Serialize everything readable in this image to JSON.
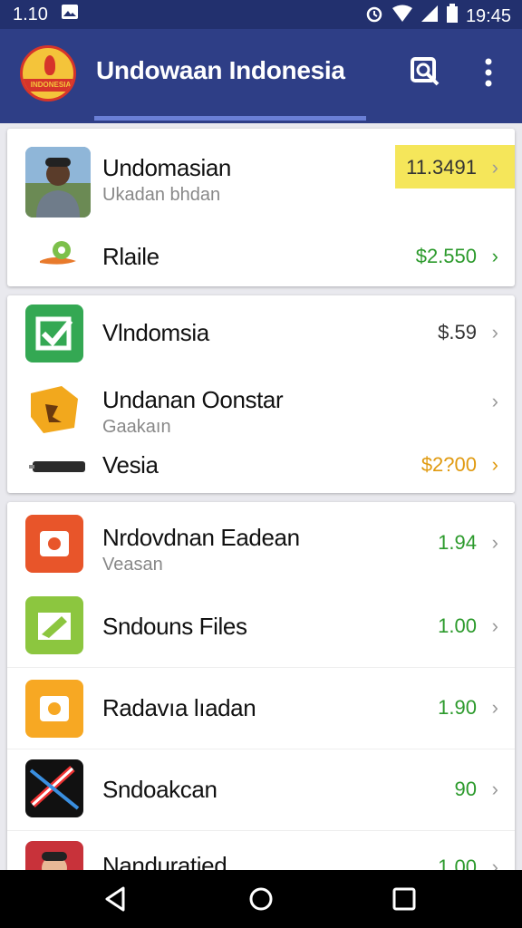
{
  "status_bar": {
    "left_time": "1.10",
    "right_time": "19:45",
    "icons": [
      "image-icon",
      "alarm-icon",
      "wifi-icon",
      "signal-icon",
      "battery-icon"
    ]
  },
  "app_bar": {
    "title": "Undowaan Indonesia",
    "logo_text": "INDONESIA",
    "actions": [
      "search-icon",
      "more-vert-icon"
    ]
  },
  "cards": [
    {
      "rows": [
        {
          "title": "Undomasian",
          "subtitle": "Ukadan bhdan",
          "value": "11.3491",
          "value_color": "#333333",
          "highlight": "#f5e65a"
        },
        {
          "title": "Rlaile",
          "subtitle": "",
          "value": "$2.550",
          "value_color": "#2c9a2c"
        }
      ]
    },
    {
      "rows": [
        {
          "title": "Vlndomsia",
          "subtitle": "",
          "value": "$.59",
          "value_color": "#333333"
        },
        {
          "title": "Undanan Oonstar",
          "subtitle": "Gaakaın",
          "value": "",
          "value_color": "#333333"
        },
        {
          "title": "Vesia",
          "subtitle": "",
          "value": "$2?00",
          "value_color": "#e09a10"
        }
      ]
    },
    {
      "rows": [
        {
          "title": "Nrdovdnan Eadean",
          "subtitle": "Veasan",
          "value": "1.94",
          "value_color": "#2c9a2c"
        },
        {
          "title": "Sndouns Files",
          "subtitle": "",
          "value": "1.00",
          "value_color": "#2c9a2c"
        },
        {
          "title": "Radavıa lıadan",
          "subtitle": "",
          "value": "1.90",
          "value_color": "#2c9a2c"
        },
        {
          "title": "Sndoakcan",
          "subtitle": "",
          "value": "90",
          "value_color": "#2c9a2c"
        },
        {
          "title": "Nanduratied",
          "subtitle": "",
          "value": "1.00",
          "value_color": "#2c9a2c"
        }
      ]
    }
  ],
  "chevron": "›",
  "nav_bar": [
    "back-icon",
    "home-icon",
    "recents-icon"
  ],
  "colors": {
    "status_bar": "#22306e",
    "app_bar": "#2e3e86",
    "accent": "#6a7fd6",
    "green": "#2c9a2c",
    "orange": "#e09a10"
  }
}
